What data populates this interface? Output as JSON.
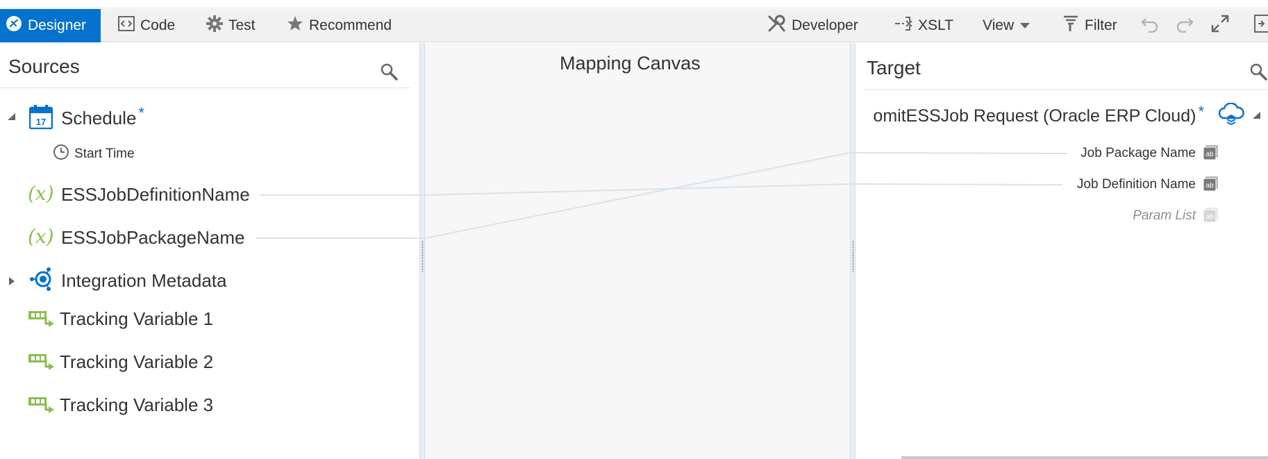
{
  "toolbar": {
    "designer": "Designer",
    "code": "Code",
    "test": "Test",
    "recommend": "Recommend",
    "developer": "Developer",
    "xslt": "XSLT",
    "view": "View",
    "filter": "Filter"
  },
  "sources": {
    "title": "Sources",
    "schedule": {
      "label": "Schedule",
      "required_mark": "*",
      "calendar_day": "17",
      "child": "Start Time"
    },
    "items": [
      {
        "label": "ESSJobDefinitionName",
        "icon": "variable-icon"
      },
      {
        "label": "ESSJobPackageName",
        "icon": "variable-icon"
      },
      {
        "label": "Integration Metadata",
        "icon": "integration-metadata-icon"
      },
      {
        "label": "Tracking Variable 1",
        "icon": "tracking-variable-icon"
      },
      {
        "label": "Tracking Variable 2",
        "icon": "tracking-variable-icon"
      },
      {
        "label": "Tracking Variable 3",
        "icon": "tracking-variable-icon"
      }
    ]
  },
  "canvas": {
    "title": "Mapping Canvas"
  },
  "target": {
    "title": "Target",
    "root": {
      "label": "omitESSJob Request (Oracle ERP Cloud)",
      "required_mark": "*"
    },
    "fields": [
      {
        "label": "Job Package Name",
        "mapped_from": "ESSJobPackageName"
      },
      {
        "label": "Job Definition Name",
        "mapped_from": "ESSJobDefinitionName"
      },
      {
        "label": "Param List",
        "mapped_from": ""
      }
    ],
    "field_icon_text": "ab"
  },
  "colors": {
    "accent": "#0572ce",
    "variable_green": "#8bbf4d",
    "map_line": "#d9e3ec"
  }
}
